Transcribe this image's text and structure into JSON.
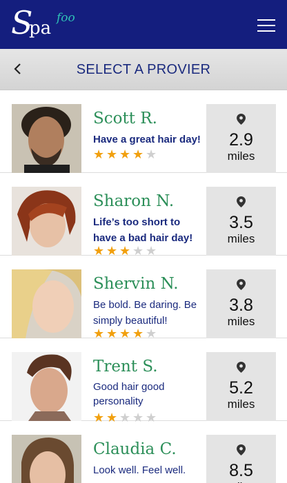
{
  "app": {
    "logo_big": "S",
    "logo_small": "pa",
    "logo_accent": "foo"
  },
  "colors": {
    "appbar": "#141e7e",
    "name": "#2c8f59",
    "text": "#1a2a7e",
    "star_on": "#f1a00f",
    "star_off": "#cfcfcf"
  },
  "header": {
    "title": "SELECT A PROVIER"
  },
  "icons": {
    "menu": "hamburger-menu-icon",
    "back": "chevron-left-icon",
    "distance": "map-pin-icon"
  },
  "providers": [
    {
      "name": "Scott R.",
      "tagline": "Have a great hair day!",
      "bold": true,
      "rating": 4,
      "distance": "2.9",
      "unit": "miles"
    },
    {
      "name": "Sharon N.",
      "tagline": "Life’s too short to have a bad hair day!",
      "bold": true,
      "rating": 3,
      "distance": "3.5",
      "unit": "miles"
    },
    {
      "name": "Shervin N.",
      "tagline": "Be bold. Be daring. Be simply beautiful!",
      "bold": false,
      "rating": 4,
      "distance": "3.8",
      "unit": "miles"
    },
    {
      "name": "Trent S.",
      "tagline": "Good hair good personality",
      "bold": false,
      "rating": 2,
      "distance": "5.2",
      "unit": "miles"
    },
    {
      "name": "Claudia C.",
      "tagline": "Look well. Feel well.",
      "bold": false,
      "rating": 0,
      "distance": "8.5",
      "unit": "miles"
    }
  ]
}
